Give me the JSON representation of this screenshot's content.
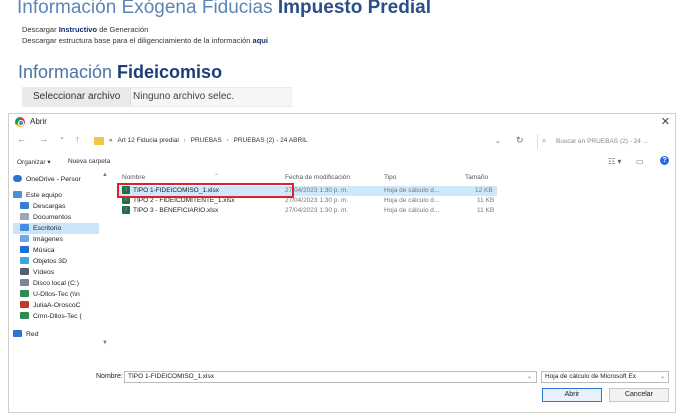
{
  "page": {
    "title_prefix": "Información Exógena Fiducias ",
    "title_bold": "Impuesto Predial",
    "line1_prefix": "Descargar ",
    "line1_link": "Instructivo",
    "line1_suffix": " de Generación",
    "line2_prefix": "Descargar estructura base para el diligenciamiento de la información ",
    "line2_link": "aqui",
    "section_prefix": "Información ",
    "section_bold": "Fideicomiso",
    "choose_file_button": "Seleccionar archivo",
    "no_file_text": "Ninguno archivo selec."
  },
  "dialog": {
    "title": "Abrir",
    "close_glyph": "✕",
    "nav": {
      "back": "←",
      "forward": "→",
      "dropdown": "⌄",
      "up": "↑"
    },
    "breadcrumb": [
      "«",
      "Art 12 Fiducia predial",
      "PRUEBAS",
      "PRUEBAS (2) - 24 ABRIL"
    ],
    "breadcrumb_sep": "›",
    "refresh_glyph": "↻",
    "search_placeholder": "Buscar en PRUEBAS (2) - 24 ...",
    "toolbar": {
      "organize": "Organizar ▾",
      "new_folder": "Nueva carpeta",
      "view_glyph": "☷ ▾",
      "pane_glyph": "▭",
      "help_glyph": "?"
    },
    "nav_items": [
      {
        "label": "OneDrive - Persor",
        "icon_color": "#2b74d4"
      },
      {
        "label": "Este equipo",
        "icon_color": "#4a90d9"
      },
      {
        "label": "Descargas",
        "icon_color": "#3a7bd5"
      },
      {
        "label": "Documentos",
        "icon_color": "#9aa7b5"
      },
      {
        "label": "Escritorio",
        "icon_color": "#3f8fe0"
      },
      {
        "label": "Imágenes",
        "icon_color": "#6aa8e8"
      },
      {
        "label": "Música",
        "icon_color": "#1b6ed6"
      },
      {
        "label": "Objetos 3D",
        "icon_color": "#36a9e1"
      },
      {
        "label": "Vídeos",
        "icon_color": "#555f6b"
      },
      {
        "label": "Disco local (C:)",
        "icon_color": "#7a8794"
      },
      {
        "label": "U-Dllos-Tec (\\\\n",
        "icon_color": "#2e8b57"
      },
      {
        "label": "JuliaA-OroscoC",
        "icon_color": "#c0392b"
      },
      {
        "label": "Cmn-Dllos-Tec (",
        "icon_color": "#2e8b57"
      },
      {
        "label": "Red",
        "icon_color": "#2b74d4"
      }
    ],
    "columns": {
      "name": "Nombre",
      "modified": "Fecha de modificación",
      "type": "Tipo",
      "size": "Tamaño"
    },
    "files": [
      {
        "name": "TIPO 1-FIDEICOMISO_1.xlsx",
        "modified": "27/04/2023 1:30 p. m.",
        "type": "Hoja de cálculo d...",
        "size": "12 KB"
      },
      {
        "name": "TIPO 2 - FIDEICOMITENTE_1.xlsx",
        "modified": "27/04/2023 1:30 p. m.",
        "type": "Hoja de cálculo d...",
        "size": "11 KB"
      },
      {
        "name": "TIPO 3 - BENEFICIARIO.xlsx",
        "modified": "27/04/2023 1:30 p. m.",
        "type": "Hoja de cálculo d...",
        "size": "11 KB"
      }
    ],
    "selected_file_index": 0,
    "filename_label": "Nombre:",
    "filename_value": "TIPO 1-FIDEICOMISO_1.xlsx",
    "filetype_value": "Hoja de cálculo de Microsoft Ex",
    "open_button": "Abrir",
    "cancel_button": "Cancelar",
    "colors": {
      "highlight_border": "#e0202a",
      "selection": "#cde8fa",
      "excel_icon": "#1e7145"
    }
  }
}
